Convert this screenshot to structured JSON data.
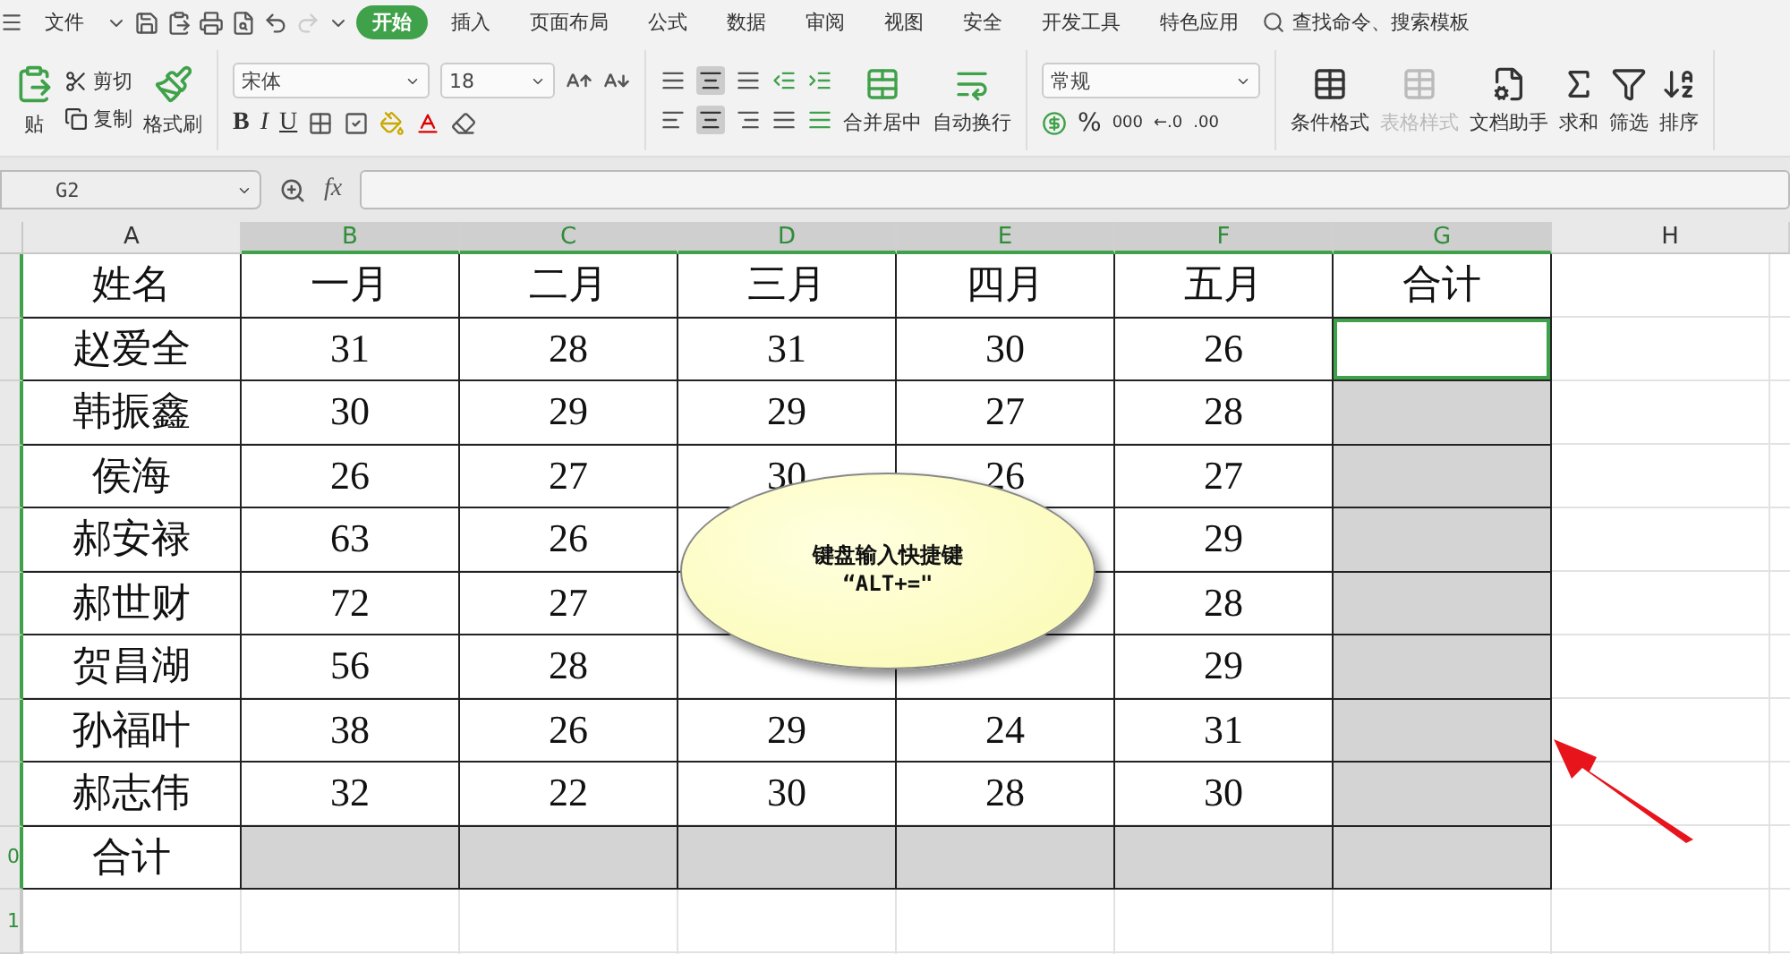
{
  "menu": {
    "file": "文件",
    "tabs": [
      {
        "label": "开始",
        "selected": true
      },
      {
        "label": "插入",
        "selected": false
      },
      {
        "label": "页面布局",
        "selected": false
      },
      {
        "label": "公式",
        "selected": false
      },
      {
        "label": "数据",
        "selected": false
      },
      {
        "label": "审阅",
        "selected": false
      },
      {
        "label": "视图",
        "selected": false
      },
      {
        "label": "安全",
        "selected": false
      },
      {
        "label": "开发工具",
        "selected": false
      },
      {
        "label": "特色应用",
        "selected": false
      }
    ],
    "search": "查找命令、搜索模板"
  },
  "ribbon": {
    "paste": "贴",
    "cut": "剪切",
    "copy": "复制",
    "format_painter": "格式刷",
    "font": "宋体",
    "font_size": "18",
    "bold": "B",
    "italic": "I",
    "underline": "U",
    "merge": "合并居中",
    "wrap": "自动换行",
    "number_format": "常规",
    "number_buttons": [
      "%",
      "000",
      "←.0",
      ".00"
    ],
    "big_buttons": [
      {
        "label": "条件格式",
        "disabled": false
      },
      {
        "label": "表格样式",
        "disabled": true
      },
      {
        "label": "文档助手",
        "disabled": false
      },
      {
        "label": "求和",
        "disabled": false
      },
      {
        "label": "筛选",
        "disabled": false
      },
      {
        "label": "排序",
        "disabled": false
      }
    ]
  },
  "formula_bar": {
    "name_box": "G2",
    "fx": "fx"
  },
  "columns": [
    {
      "label": "A",
      "selected": false
    },
    {
      "label": "B",
      "selected": true
    },
    {
      "label": "C",
      "selected": true
    },
    {
      "label": "D",
      "selected": true
    },
    {
      "label": "E",
      "selected": true
    },
    {
      "label": "F",
      "selected": true
    },
    {
      "label": "G",
      "selected": true
    },
    {
      "label": "H",
      "selected": false
    }
  ],
  "rows": [
    {
      "cells": [
        {
          "text": "姓名",
          "shaded": false,
          "active": false
        },
        {
          "text": "一月",
          "shaded": false,
          "active": false
        },
        {
          "text": "二月",
          "shaded": false,
          "active": false
        },
        {
          "text": "三月",
          "shaded": false,
          "active": false
        },
        {
          "text": "四月",
          "shaded": false,
          "active": false
        },
        {
          "text": "五月",
          "shaded": false,
          "active": false
        },
        {
          "text": "合计",
          "shaded": false,
          "active": false
        }
      ]
    },
    {
      "cells": [
        {
          "text": "赵爱全",
          "shaded": false,
          "active": false
        },
        {
          "text": "31",
          "shaded": false,
          "active": false
        },
        {
          "text": "28",
          "shaded": false,
          "active": false
        },
        {
          "text": "31",
          "shaded": false,
          "active": false
        },
        {
          "text": "30",
          "shaded": false,
          "active": false
        },
        {
          "text": "26",
          "shaded": false,
          "active": false
        },
        {
          "text": null,
          "shaded": false,
          "active": true
        }
      ]
    },
    {
      "cells": [
        {
          "text": "韩振鑫",
          "shaded": false,
          "active": false
        },
        {
          "text": "30",
          "shaded": false,
          "active": false
        },
        {
          "text": "29",
          "shaded": false,
          "active": false
        },
        {
          "text": "29",
          "shaded": false,
          "active": false
        },
        {
          "text": "27",
          "shaded": false,
          "active": false
        },
        {
          "text": "28",
          "shaded": false,
          "active": false
        },
        {
          "text": null,
          "shaded": true,
          "active": false
        }
      ]
    },
    {
      "cells": [
        {
          "text": "侯海",
          "shaded": false,
          "active": false
        },
        {
          "text": "26",
          "shaded": false,
          "active": false
        },
        {
          "text": "27",
          "shaded": false,
          "active": false
        },
        {
          "text": "30",
          "shaded": false,
          "active": false
        },
        {
          "text": "26",
          "shaded": false,
          "active": false
        },
        {
          "text": "27",
          "shaded": false,
          "active": false
        },
        {
          "text": null,
          "shaded": true,
          "active": false
        }
      ]
    },
    {
      "cells": [
        {
          "text": "郝安禄",
          "shaded": false,
          "active": false
        },
        {
          "text": "63",
          "shaded": false,
          "active": false
        },
        {
          "text": "26",
          "shaded": false,
          "active": false
        },
        {
          "text": null,
          "shaded": false,
          "active": false
        },
        {
          "text": null,
          "shaded": false,
          "active": false
        },
        {
          "text": "29",
          "shaded": false,
          "active": false
        },
        {
          "text": null,
          "shaded": true,
          "active": false
        }
      ]
    },
    {
      "cells": [
        {
          "text": "郝世财",
          "shaded": false,
          "active": false
        },
        {
          "text": "72",
          "shaded": false,
          "active": false
        },
        {
          "text": "27",
          "shaded": false,
          "active": false
        },
        {
          "text": null,
          "shaded": false,
          "active": false
        },
        {
          "text": null,
          "shaded": false,
          "active": false
        },
        {
          "text": "28",
          "shaded": false,
          "active": false
        },
        {
          "text": null,
          "shaded": true,
          "active": false
        }
      ]
    },
    {
      "cells": [
        {
          "text": "贺昌湖",
          "shaded": false,
          "active": false
        },
        {
          "text": "56",
          "shaded": false,
          "active": false
        },
        {
          "text": "28",
          "shaded": false,
          "active": false
        },
        {
          "text": null,
          "shaded": false,
          "active": false
        },
        {
          "text": null,
          "shaded": false,
          "active": false
        },
        {
          "text": "29",
          "shaded": false,
          "active": false
        },
        {
          "text": null,
          "shaded": true,
          "active": false
        }
      ]
    },
    {
      "cells": [
        {
          "text": "孙福叶",
          "shaded": false,
          "active": false
        },
        {
          "text": "38",
          "shaded": false,
          "active": false
        },
        {
          "text": "26",
          "shaded": false,
          "active": false
        },
        {
          "text": "29",
          "shaded": false,
          "active": false
        },
        {
          "text": "24",
          "shaded": false,
          "active": false
        },
        {
          "text": "31",
          "shaded": false,
          "active": false
        },
        {
          "text": null,
          "shaded": true,
          "active": false
        }
      ]
    },
    {
      "cells": [
        {
          "text": "郝志伟",
          "shaded": false,
          "active": false
        },
        {
          "text": "32",
          "shaded": false,
          "active": false
        },
        {
          "text": "22",
          "shaded": false,
          "active": false
        },
        {
          "text": "30",
          "shaded": false,
          "active": false
        },
        {
          "text": "28",
          "shaded": false,
          "active": false
        },
        {
          "text": "30",
          "shaded": false,
          "active": false
        },
        {
          "text": null,
          "shaded": true,
          "active": false
        }
      ]
    },
    {
      "header": "0",
      "cells": [
        {
          "text": "合计",
          "shaded": false,
          "active": false
        },
        {
          "text": null,
          "shaded": true,
          "active": false
        },
        {
          "text": null,
          "shaded": true,
          "active": false
        },
        {
          "text": null,
          "shaded": true,
          "active": false
        },
        {
          "text": null,
          "shaded": true,
          "active": false
        },
        {
          "text": null,
          "shaded": true,
          "active": false
        },
        {
          "text": null,
          "shaded": true,
          "active": false
        }
      ]
    }
  ],
  "empty_rows": [
    {
      "header": "1"
    }
  ],
  "callout": {
    "lines": [
      "键盘输入快捷键",
      "“ALT+=\""
    ]
  }
}
